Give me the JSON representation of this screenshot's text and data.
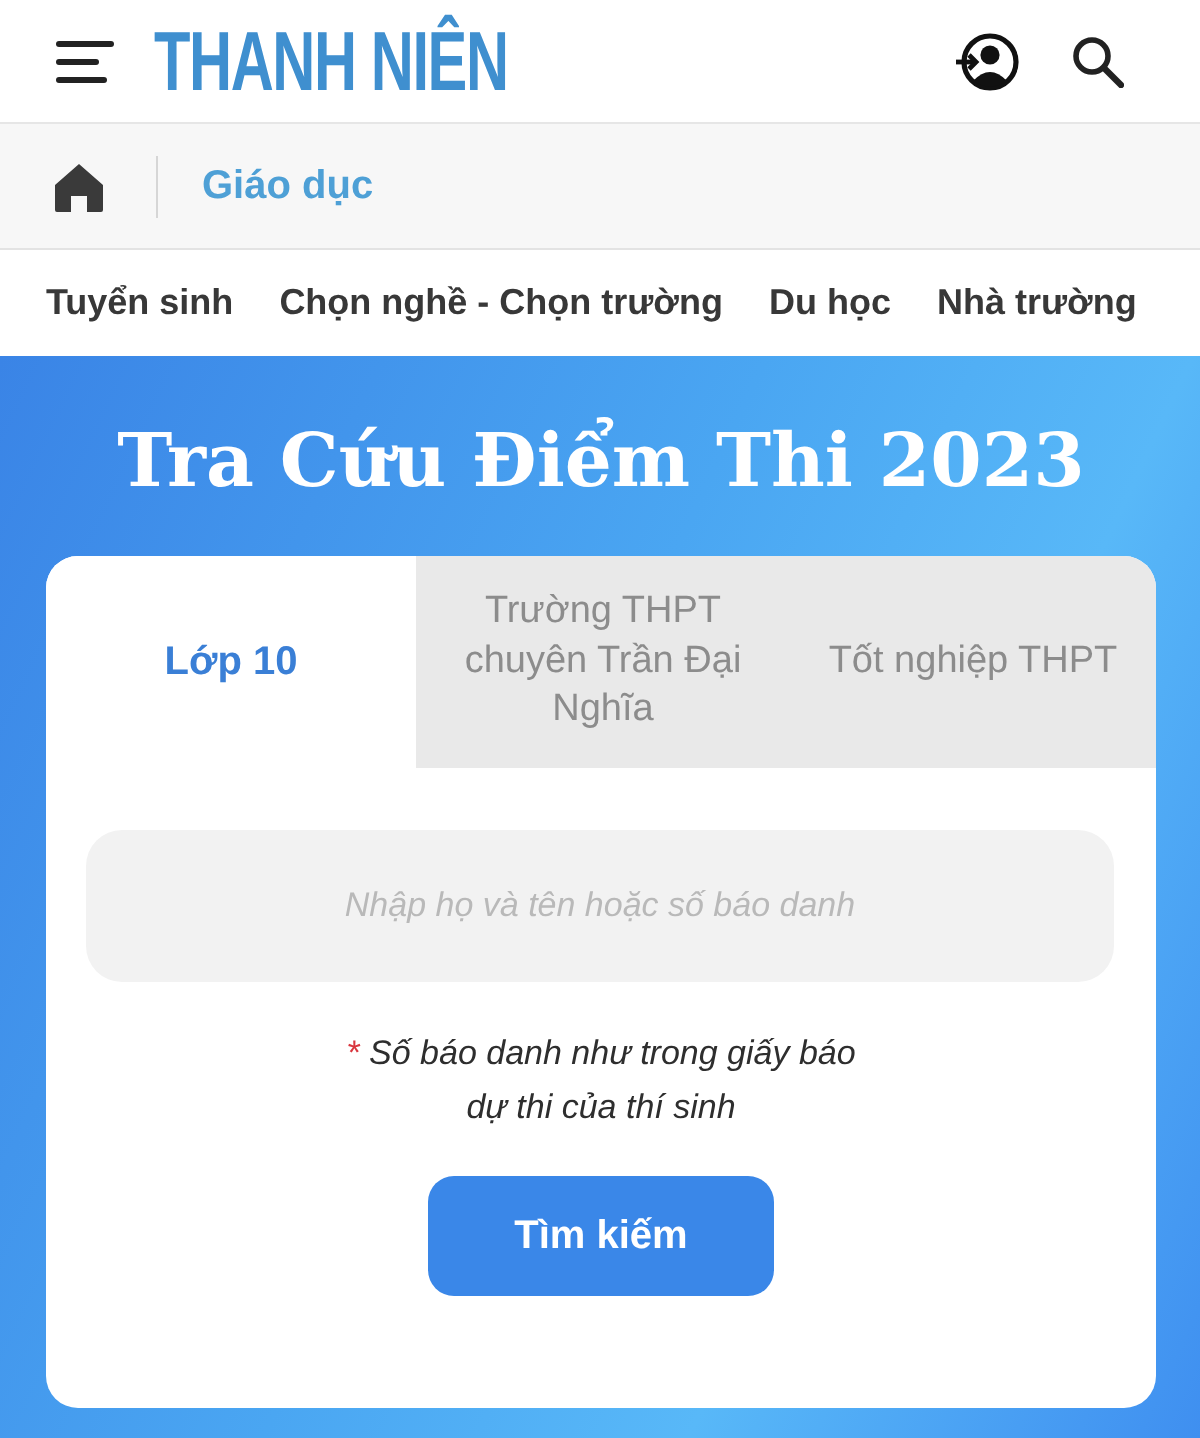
{
  "header": {
    "logo": "THANH NIÊN"
  },
  "breadcrumb": {
    "section": "Giáo dục"
  },
  "categories": [
    "Tuyển sinh",
    "Chọn nghề - Chọn trường",
    "Du học",
    "Nhà trường"
  ],
  "lookup": {
    "title": "Tra Cứu Điểm Thi 2023",
    "tabs": [
      {
        "label": "Lớp 10",
        "selected": true
      },
      {
        "label": "Trường THPT chuyên Trần Đại Nghĩa",
        "selected": false
      },
      {
        "label": "Tốt nghiệp THPT",
        "selected": false
      }
    ],
    "search": {
      "placeholder": "Nhập họ và tên hoặc số báo danh"
    },
    "note": {
      "mark": "*",
      "text": "Số báo danh như trong giấy báo dự thi của thí sinh"
    },
    "button": "Tìm kiếm"
  }
}
